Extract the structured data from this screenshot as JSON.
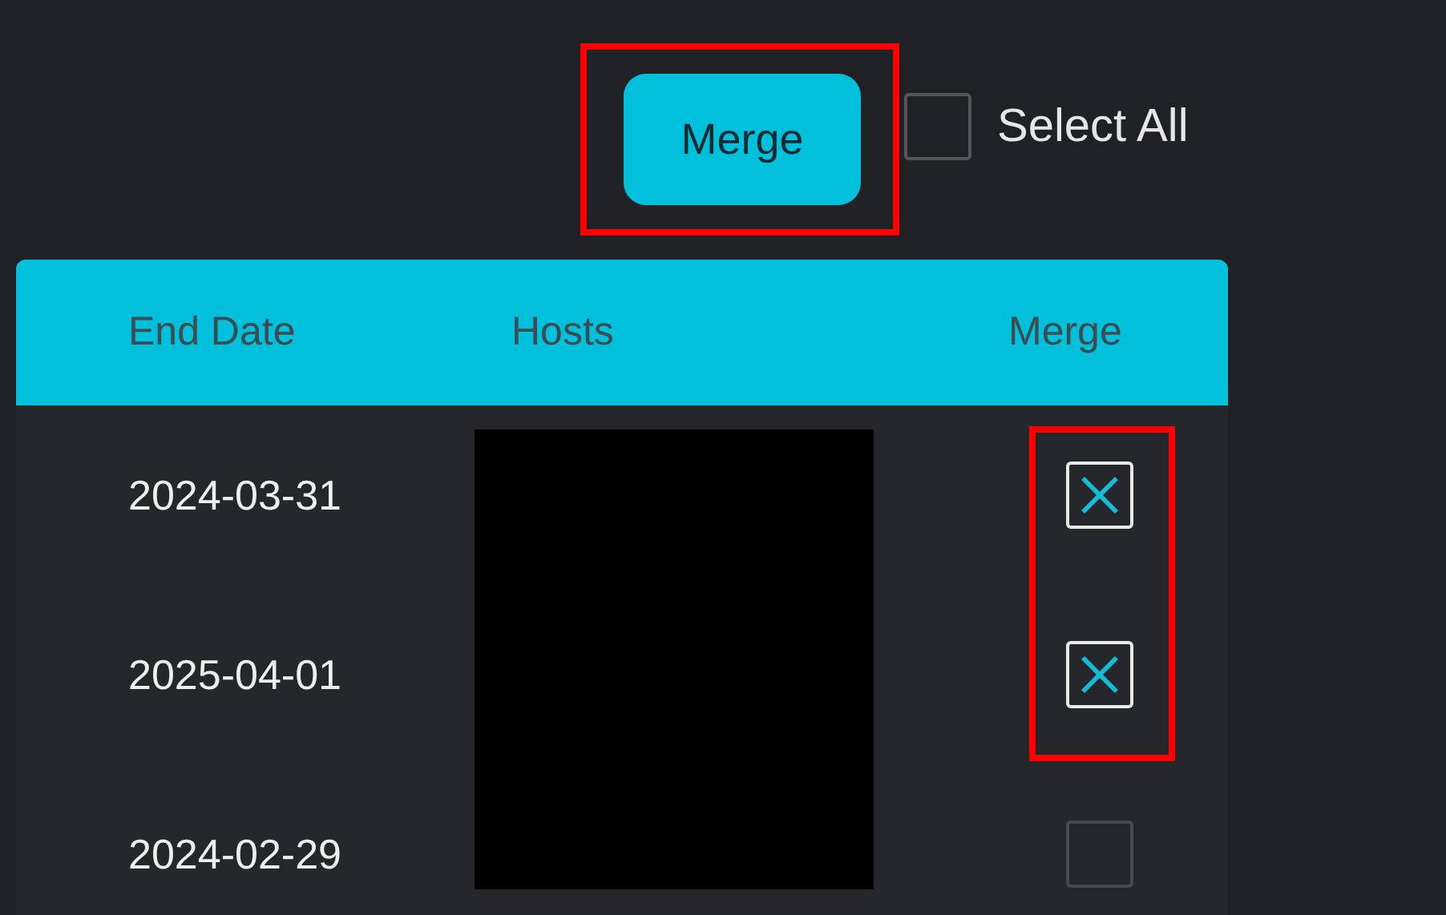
{
  "merge_button": {
    "label": "Merge",
    "highlighted": true
  },
  "select_all": {
    "label": "Select All",
    "checked": false
  },
  "table": {
    "columns": [
      "End Date",
      "Hosts",
      "Merge"
    ],
    "hosts_redacted": true,
    "rows": [
      {
        "end_date": "2024-03-31",
        "merge": true,
        "highlighted": true
      },
      {
        "end_date": "2025-04-01",
        "merge": true,
        "highlighted": true
      },
      {
        "end_date": "2024-02-29",
        "merge": false,
        "highlighted": false
      }
    ]
  }
}
